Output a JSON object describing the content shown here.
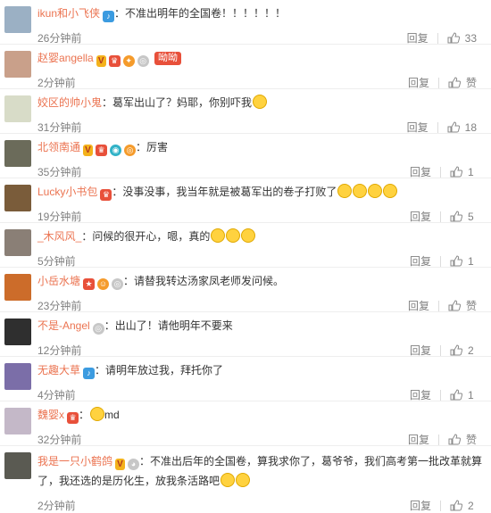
{
  "reply_label": "回复",
  "like_label": "赞",
  "comments": [
    {
      "user": "ikun和小飞侠",
      "text": "：不准出明年的全国卷！！！！！！",
      "time": "26分钟前",
      "likes": "33",
      "avatar": "#9bb0c4"
    },
    {
      "user": "赵婴angella",
      "text": "",
      "tag": "呦呦",
      "time": "2分钟前",
      "likes": "赞",
      "avatar": "#c9a08a"
    },
    {
      "user": "姣区的帅小鬼",
      "text": "：葛军出山了？妈耶，你别吓我",
      "time": "31分钟前",
      "likes": "18",
      "avatar": "#d8dcc8"
    },
    {
      "user": "北领南通",
      "text": "：厉害",
      "time": "35分钟前",
      "likes": "1",
      "avatar": "#6b6b5a"
    },
    {
      "user": "Lucky小书包",
      "text": "：没事没事，我当年就是被葛军出的卷子打败了",
      "time": "19分钟前",
      "likes": "5",
      "avatar": "#7a5c3a"
    },
    {
      "user": "_木风风_",
      "text": "：问候的很开心，嗯，真的",
      "time": "5分钟前",
      "likes": "1",
      "avatar": "#8a7f76"
    },
    {
      "user": "小岳水塘",
      "text": "：请替我转达汤家凤老师发问候。",
      "time": "23分钟前",
      "likes": "赞",
      "avatar": "#cc6c2a"
    },
    {
      "user": "不是-Angel",
      "text": "：出山了！请他明年不要来",
      "time": "12分钟前",
      "likes": "2",
      "avatar": "#2f2f2f"
    },
    {
      "user": "无趣大草",
      "text": "：请明年放过我，拜托你了",
      "time": "4分钟前",
      "likes": "1",
      "avatar": "#7b6ea8"
    },
    {
      "user": "魏婴x",
      "text": "：md",
      "time": "32分钟前",
      "likes": "赞",
      "avatar": "#c4b8c8"
    },
    {
      "user": "我是一只小鹤鸽",
      "text": "：不准出后年的全国卷，算我求你了，葛爷爷，我们高考第一批改革就算了，我还选的是历化生，放我条活路吧",
      "time": "2分钟前",
      "likes": "2",
      "avatar": "#5a5a52"
    }
  ]
}
